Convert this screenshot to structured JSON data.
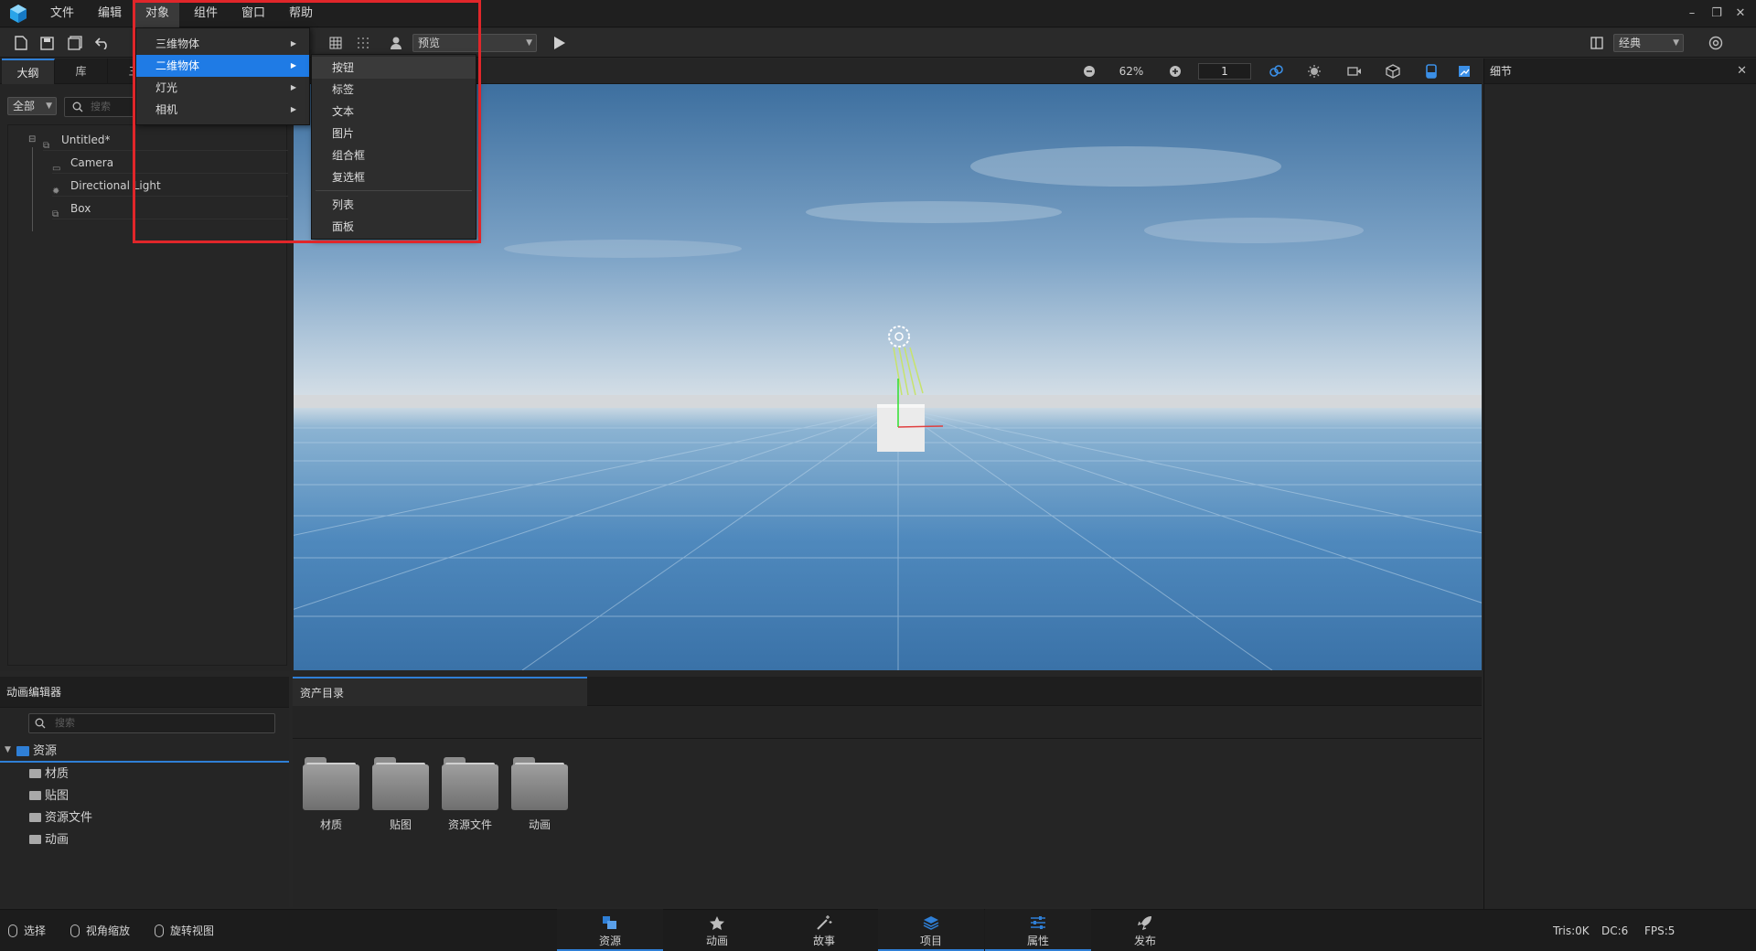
{
  "menubar": {
    "items": [
      "文件",
      "编辑",
      "对象",
      "组件",
      "窗口",
      "帮助"
    ]
  },
  "toolbar": {
    "preview_select": "预览",
    "layout_select": "经典"
  },
  "outline": {
    "tabs": [
      "大纲",
      "库",
      "三"
    ],
    "filter_select": "全部",
    "search_placeholder": "搜索",
    "tree": [
      {
        "label": "Untitled*"
      },
      {
        "label": "Camera"
      },
      {
        "label": "Directional Light"
      },
      {
        "label": "Box"
      }
    ]
  },
  "viewport": {
    "zoom": "62%",
    "frame": "1"
  },
  "details": {
    "title": "细节"
  },
  "object_menu": {
    "items": [
      {
        "label": "三维物体"
      },
      {
        "label": "二维物体"
      },
      {
        "label": "灯光"
      },
      {
        "label": "相机"
      }
    ],
    "submenu": [
      "按钮",
      "标签",
      "文本",
      "图片",
      "组合框",
      "复选框",
      "列表",
      "面板"
    ]
  },
  "anim_editor": {
    "title": "动画编辑器",
    "search_placeholder": "搜索",
    "root": "资源",
    "folders": [
      "材质",
      "贴图",
      "资源文件",
      "动画"
    ]
  },
  "assets": {
    "tab": "资产目录",
    "folders": [
      "材质",
      "贴图",
      "资源文件",
      "动画"
    ]
  },
  "statusbar": {
    "hints": [
      "选择",
      "视角缩放",
      "旋转视图"
    ],
    "nav_tabs": [
      "资源",
      "动画",
      "故事",
      "项目",
      "属性",
      "发布"
    ],
    "stats": {
      "tris": "Tris:0K",
      "dc": "DC:6",
      "fps": "FPS:5"
    }
  },
  "colors": {
    "accent": "#2f7fd6",
    "menu_highlight": "#1f7be5",
    "annotation_box": "#e0262a"
  }
}
